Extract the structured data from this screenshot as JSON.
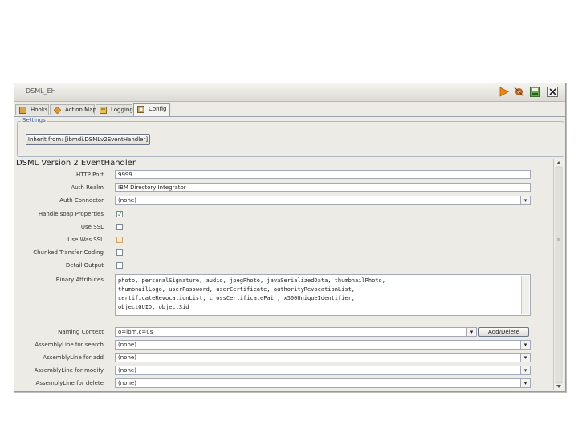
{
  "window": {
    "title": "DSML_EH",
    "controls": [
      "run-icon",
      "debug-icon",
      "save-icon",
      "close-icon"
    ]
  },
  "tabs": [
    {
      "label": "Hooks",
      "icon": "hooks-icon",
      "active": false
    },
    {
      "label": "Action Map",
      "icon": "action-map-icon",
      "active": false
    },
    {
      "label": "Logging",
      "icon": "logging-icon",
      "active": false
    },
    {
      "label": "Config",
      "icon": "config-icon",
      "active": true
    }
  ],
  "settings": {
    "group_label": "Settings",
    "inherit_button": "Inherit from: [ibmdi.DSMLv2EventHandler]"
  },
  "form": {
    "title": "DSML Version 2 EventHandler",
    "http_port": {
      "label": "HTTP Port",
      "value": "9999"
    },
    "auth_realm": {
      "label": "Auth Realm",
      "value": "IBM Directory Integrator"
    },
    "auth_connector": {
      "label": "Auth Connector",
      "value": "(none)"
    },
    "handle_soap_properties": {
      "label": "Handle soap Properties",
      "checked": true
    },
    "use_ssl": {
      "label": "Use SSL",
      "checked": false
    },
    "use_was_ssl": {
      "label": "Use Was SSL",
      "checked": false
    },
    "chunked_transfer_coding": {
      "label": "Chunked Transfer Coding",
      "checked": false
    },
    "detail_output": {
      "label": "Detail Output",
      "checked": false
    },
    "binary_attributes": {
      "label": "Binary Attributes",
      "lines": [
        "photo, personalSignature, audio, jpegPhoto, javaSerializedData, thumbnailPhoto,",
        "thumbnailLogo, userPassword, userCertificate, authorityRevocationList,",
        "certificateRevocationList, crossCertificatePair, x500UniqueIdentifier,",
        "objectGUID, objectSid"
      ]
    },
    "naming_context": {
      "label": "Naming Context",
      "value": "o=ibm,c=us",
      "button": "Add/Delete"
    },
    "assembly_line_for_search": {
      "label": "AssemblyLine for search",
      "value": "(none)"
    },
    "assembly_line_for_add": {
      "label": "AssemblyLine for add",
      "value": "(none)"
    },
    "assembly_line_for_modify": {
      "label": "AssemblyLine for modify",
      "value": "(none)"
    },
    "assembly_line_for_delete": {
      "label": "AssemblyLine for delete",
      "value": "(none)"
    }
  },
  "colors": {
    "accent": "#3b5ea8",
    "check": "#2a8a2a",
    "run": "#e88a12"
  }
}
